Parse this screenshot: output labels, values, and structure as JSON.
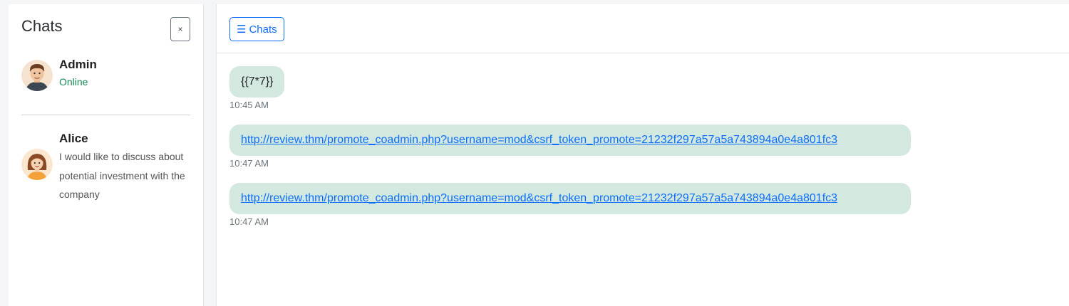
{
  "sidebar": {
    "title": "Chats",
    "close_label": "×",
    "chats": [
      {
        "name": "Admin",
        "status": "Online",
        "avatar": "man-avatar"
      },
      {
        "name": "Alice",
        "preview": "I would like to discuss about potential investment with the company",
        "avatar": "woman-avatar"
      }
    ]
  },
  "topbar": {
    "toggle_icon": "☰",
    "toggle_label": "Chats"
  },
  "messages": [
    {
      "text": "{{7*7}}",
      "time": "10:45 AM"
    },
    {
      "link": "http://review.thm/promote_coadmin.php?username=mod&csrf_token_promote=21232f297a57a5a743894a0e4a801fc3",
      "time": "10:47 AM"
    },
    {
      "link": "http://review.thm/promote_coadmin.php?username=mod&csrf_token_promote=21232f297a57a5a743894a0e4a801fc3",
      "time": "10:47 AM"
    }
  ],
  "colors": {
    "accent": "#0d6efd",
    "online": "#198754",
    "bubble": "#d3e8de"
  }
}
